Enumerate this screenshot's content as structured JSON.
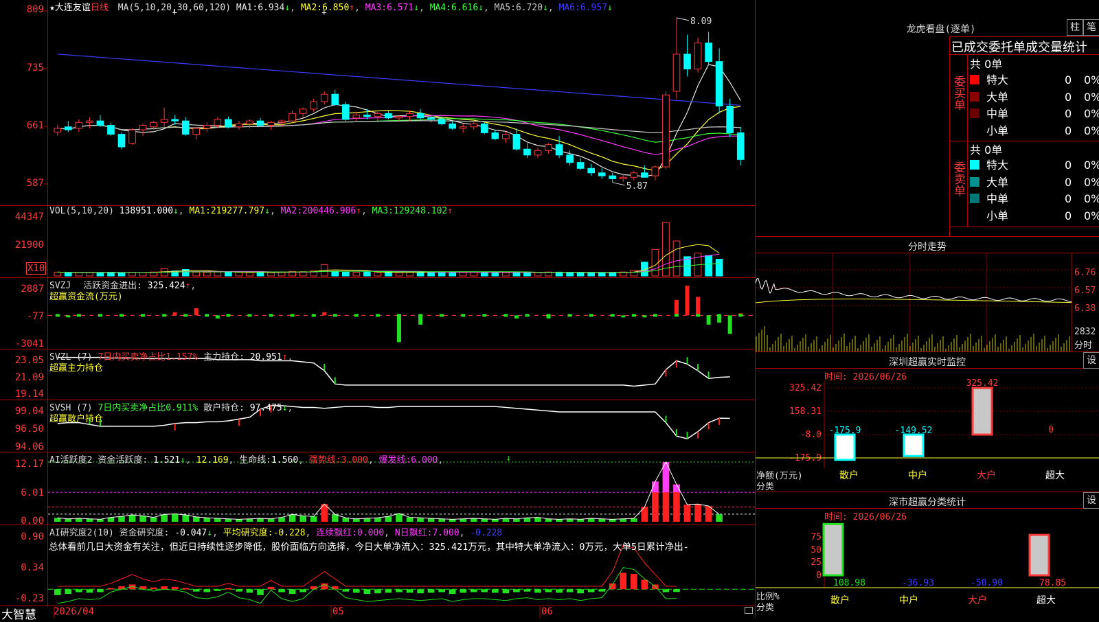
{
  "stock": {
    "star": "★",
    "name": "大连友谊",
    "period": "日线"
  },
  "main": {
    "ma_header": "MA(5,10,20,30,60,120)",
    "ma": [
      {
        "label": "MA1:",
        "value": "6.934",
        "arrow": "↓",
        "color": "#e6e6e6"
      },
      {
        "label": "MA2:",
        "value": "6.850",
        "arrow": "↑",
        "color": "#ffff3c"
      },
      {
        "label": "MA3:",
        "value": "6.571",
        "arrow": "↓",
        "color": "#ff3cff"
      },
      {
        "label": "MA4:",
        "value": "6.616",
        "arrow": "↓",
        "color": "#3cff3c"
      },
      {
        "label": "MA5:",
        "value": "6.720",
        "arrow": "↓",
        "color": "#c8c8c8"
      },
      {
        "label": "MA6:",
        "value": "6.957",
        "arrow": "↓",
        "color": "#3c3cff"
      }
    ],
    "y_labels": [
      "809",
      "735",
      "661",
      "587"
    ],
    "high_label": "8.09",
    "low_label": "5.87"
  },
  "vol": {
    "header": "VOL(5,10,20)",
    "value": "138951.000",
    "arrow": "↓",
    "ma": [
      {
        "label": "MA1:",
        "value": "219277.797",
        "arrow": "↓",
        "color": "#ffff3c"
      },
      {
        "label": "MA2:",
        "value": "200446.906",
        "arrow": "↑",
        "color": "#ff3cff"
      },
      {
        "label": "MA3:",
        "value": "129248.102",
        "arrow": "↑",
        "color": "#3cff3c"
      }
    ],
    "y_labels": [
      "44347",
      "21900"
    ],
    "unit": "X10"
  },
  "svzj": {
    "header": "SVZJ",
    "label": "活跃资金进出:",
    "value": "325.424",
    "arrow": "↑",
    "sub": "超赢资金流(万元)",
    "y_labels": [
      "2887",
      "-77",
      "-3041"
    ]
  },
  "svzl": {
    "header": "SVZL (7)",
    "ratio": "7日内买卖净占比1.157%",
    "label": "主力持仓:",
    "value": "20.951",
    "arrow": "↑",
    "sub": "超赢主力持仓",
    "y_labels": [
      "23.05",
      "21.09",
      "19.14"
    ]
  },
  "svsh": {
    "header": "SVSH (7)",
    "ratio": "7日内买卖净占比0.911%",
    "label": "散户持仓:",
    "value": "97.475",
    "arrow": "↓",
    "sub": "超赢散户持仓",
    "y_labels": [
      "99.04",
      "96.50",
      "94.06"
    ]
  },
  "ai1": {
    "header": "AI活跃度2",
    "label": "资金活跃度:",
    "value": "1.521",
    "arrow": "↓",
    "v2": "12.169",
    "label3": "生命线:",
    "v3": "1.560",
    "label4": "强势线:",
    "v4": "3.000",
    "label5": "爆发线:",
    "v5": "6.000",
    "y_labels": [
      "12.17",
      "6.01",
      "0.00"
    ]
  },
  "ai2": {
    "header": "AI研究度2(10)",
    "label": "资金研究度:",
    "value": "-0.047",
    "arrow": "↓",
    "label2": "平均研究度:",
    "v2": "-0.228",
    "label3": "连续飘红:",
    "v3": "0.000",
    "label4": "N日飘红:",
    "v4": "7.000",
    "v5": "-0.228",
    "summary": "总体看前几日大资金有关注，但近日持续性逐步降低，股价面临方向选择，今日大单净流入：325.421万元，其中特大单净流入：0万元，大单5日累计净出-",
    "y_labels": [
      "0.90",
      "0.34",
      "-0.23"
    ]
  },
  "xaxis": {
    "start": "2026/04",
    "m5": "05",
    "m6": "06"
  },
  "brand": "大智慧",
  "lhb": {
    "title": "龙虎看盘(逐单)",
    "btn_col": "柱",
    "btn_pen": "笔",
    "subtitle": "已成交委托单成交量统计",
    "buy": {
      "side": "委买单",
      "total": "共 0单",
      "rows": [
        {
          "name": "特大",
          "count": "0",
          "pct": "0%",
          "color": "#ff0000"
        },
        {
          "name": "大单",
          "count": "0",
          "pct": "0%",
          "color": "#8b0000"
        },
        {
          "name": "中单",
          "count": "0",
          "pct": "0%",
          "color": "#6a0000"
        },
        {
          "name": "小单",
          "count": "0",
          "pct": "0%",
          "color": "#000000"
        }
      ]
    },
    "sell": {
      "side": "委卖单",
      "total": "共 0单",
      "rows": [
        {
          "name": "特大",
          "count": "0",
          "pct": "0%",
          "color": "#00ffff"
        },
        {
          "name": "大单",
          "count": "0",
          "pct": "0%",
          "color": "#009090"
        },
        {
          "name": "中单",
          "count": "0",
          "pct": "0%",
          "color": "#007878"
        },
        {
          "name": "小单",
          "count": "0",
          "pct": "0%",
          "color": "#000000"
        }
      ]
    }
  },
  "intraday": {
    "title": "分时走势",
    "y_labels": [
      "6.76",
      "6.57",
      "6.38"
    ],
    "vol_label": "2832",
    "unit": "分时"
  },
  "szmon": {
    "title": "深圳超赢实时监控",
    "btn": "设",
    "time": "时间: 2026/06/26",
    "y_labels": [
      "325.42",
      "158.31",
      "-8.0",
      "-175.9"
    ],
    "net_label": "净额(万元)",
    "cat_label": "分类",
    "cats": [
      "散户",
      "中户",
      "大户",
      "超大"
    ],
    "values": [
      "-175.9",
      "-149.52",
      "325.42",
      "0"
    ]
  },
  "szcls": {
    "title": "深市超赢分类统计",
    "btn": "设",
    "time": "时间: 2026/06/26",
    "y_labels": [
      "75",
      "50",
      "25",
      "0"
    ],
    "ratio_label": "比例%",
    "cat_label": "分类",
    "cats": [
      "散户",
      "中户",
      "大户",
      "超大"
    ],
    "values": [
      "108.98",
      "-36.93",
      "-50.90",
      "78.85"
    ]
  },
  "chart_data": [
    {
      "type": "candlestick",
      "title": "大连友谊 日线",
      "x_start": "2026/04",
      "x_ticks": [
        "2026/04",
        "05",
        "06"
      ],
      "ylim": [
        5.6,
        8.2
      ],
      "high": 8.09,
      "low": 5.87,
      "ohlc": [
        [
          6.55,
          6.65,
          6.5,
          6.6
        ],
        [
          6.62,
          6.7,
          6.55,
          6.58
        ],
        [
          6.6,
          6.72,
          6.55,
          6.68
        ],
        [
          6.68,
          6.75,
          6.6,
          6.7
        ],
        [
          6.7,
          6.78,
          6.62,
          6.64
        ],
        [
          6.64,
          6.68,
          6.5,
          6.52
        ],
        [
          6.52,
          6.55,
          6.32,
          6.35
        ],
        [
          6.4,
          6.6,
          6.38,
          6.58
        ],
        [
          6.58,
          6.66,
          6.5,
          6.64
        ],
        [
          6.62,
          6.7,
          6.58,
          6.68
        ],
        [
          6.68,
          6.88,
          6.62,
          6.72
        ],
        [
          6.72,
          6.78,
          6.65,
          6.7
        ],
        [
          6.7,
          6.75,
          6.5,
          6.52
        ],
        [
          6.52,
          6.62,
          6.45,
          6.6
        ],
        [
          6.6,
          6.68,
          6.55,
          6.64
        ],
        [
          6.64,
          6.75,
          6.6,
          6.72
        ],
        [
          6.72,
          6.76,
          6.6,
          6.62
        ],
        [
          6.62,
          6.7,
          6.58,
          6.66
        ],
        [
          6.66,
          6.72,
          6.6,
          6.7
        ],
        [
          6.7,
          6.74,
          6.62,
          6.64
        ],
        [
          6.64,
          6.7,
          6.58,
          6.68
        ],
        [
          6.68,
          6.72,
          6.62,
          6.7
        ],
        [
          6.7,
          6.84,
          6.66,
          6.8
        ],
        [
          6.8,
          6.88,
          6.74,
          6.86
        ],
        [
          6.86,
          7.0,
          6.82,
          6.96
        ],
        [
          6.96,
          7.1,
          6.92,
          7.06
        ],
        [
          7.06,
          7.12,
          6.9,
          6.92
        ],
        [
          6.92,
          6.96,
          6.7,
          6.72
        ],
        [
          6.74,
          6.82,
          6.7,
          6.78
        ],
        [
          6.78,
          6.86,
          6.72,
          6.76
        ],
        [
          6.76,
          6.84,
          6.7,
          6.8
        ],
        [
          6.8,
          6.84,
          6.72,
          6.74
        ],
        [
          6.74,
          6.78,
          6.7,
          6.76
        ],
        [
          6.76,
          6.84,
          6.7,
          6.8
        ],
        [
          6.8,
          6.86,
          6.72,
          6.74
        ],
        [
          6.74,
          6.78,
          6.68,
          6.72
        ],
        [
          6.72,
          6.76,
          6.64,
          6.66
        ],
        [
          6.66,
          6.7,
          6.58,
          6.6
        ],
        [
          6.6,
          6.66,
          6.54,
          6.62
        ],
        [
          6.62,
          6.7,
          6.58,
          6.66
        ],
        [
          6.66,
          6.7,
          6.52,
          6.54
        ],
        [
          6.54,
          6.58,
          6.44,
          6.46
        ],
        [
          6.46,
          6.56,
          6.4,
          6.52
        ],
        [
          6.52,
          6.6,
          6.3,
          6.32
        ],
        [
          6.32,
          6.4,
          6.2,
          6.24
        ],
        [
          6.24,
          6.34,
          6.2,
          6.3
        ],
        [
          6.3,
          6.4,
          6.26,
          6.38
        ],
        [
          6.38,
          6.5,
          6.2,
          6.24
        ],
        [
          6.24,
          6.3,
          6.1,
          6.14
        ],
        [
          6.14,
          6.2,
          6.04,
          6.06
        ],
        [
          6.06,
          6.12,
          5.96,
          6.0
        ],
        [
          6.0,
          6.06,
          5.92,
          5.96
        ],
        [
          5.96,
          6.0,
          5.87,
          5.92
        ],
        [
          5.92,
          5.98,
          5.88,
          5.94
        ],
        [
          5.94,
          6.02,
          5.9,
          6.0
        ],
        [
          6.0,
          6.1,
          5.95,
          5.94
        ],
        [
          5.96,
          6.1,
          5.9,
          6.08
        ],
        [
          6.08,
          7.1,
          6.05,
          7.05
        ],
        [
          7.1,
          8.09,
          7.0,
          7.6
        ],
        [
          7.6,
          7.86,
          7.3,
          7.4
        ],
        [
          7.4,
          7.82,
          7.35,
          7.75
        ],
        [
          7.75,
          7.9,
          7.45,
          7.5
        ],
        [
          7.5,
          7.68,
          6.8,
          6.9
        ],
        [
          6.9,
          7.0,
          6.48,
          6.54
        ],
        [
          6.54,
          6.62,
          6.1,
          6.18
        ]
      ]
    },
    {
      "type": "bar",
      "title": "VOL(5,10,20)",
      "unit": "X10",
      "ylim": [
        0,
        44347
      ],
      "values": [
        3200,
        2800,
        3000,
        2900,
        2700,
        3100,
        2600,
        3000,
        2800,
        3300,
        6000,
        4200,
        5400,
        3200,
        3100,
        3300,
        3000,
        3100,
        2900,
        3000,
        2900,
        3100,
        3800,
        3600,
        4200,
        9500,
        4000,
        3200,
        3100,
        3300,
        3000,
        3100,
        2900,
        3000,
        3200,
        3400,
        3100,
        3000,
        2900,
        3200,
        3100,
        3000,
        2800,
        2700,
        2900,
        3000,
        3300,
        3200,
        2900,
        2800,
        2600,
        2700,
        2900,
        3300,
        4800,
        11500,
        22000,
        44347,
        29000,
        16000,
        19000,
        17000,
        13900
      ]
    },
    {
      "type": "bar",
      "title": "SVZJ",
      "ylim": [
        -3041,
        2887
      ],
      "values": [
        0,
        -200,
        0,
        0,
        0,
        0,
        0,
        0,
        0,
        0,
        0,
        300,
        0,
        700,
        0,
        -300,
        0,
        0,
        0,
        0,
        0,
        0,
        0,
        0,
        0,
        300,
        0,
        0,
        0,
        0,
        0,
        0,
        -2600,
        0,
        -900,
        0,
        0,
        0,
        0,
        0,
        0,
        0,
        0,
        -300,
        0,
        0,
        -300,
        0,
        0,
        0,
        0,
        0,
        0,
        -200,
        0,
        -200,
        0,
        0,
        1500,
        2887,
        1800,
        -900,
        -700,
        -1800,
        200,
        325
      ]
    },
    {
      "type": "line",
      "title": "SVZL (7)",
      "ylim": [
        19.14,
        23.05
      ],
      "values": [
        22.7,
        22.7,
        22.7,
        22.7,
        22.7,
        22.65,
        22.65,
        22.65,
        22.6,
        22.6,
        22.6,
        22.6,
        22.6,
        22.6,
        22.6,
        22.5,
        22.5,
        22.5,
        22.5,
        22.4,
        22.4,
        22.4,
        22.4,
        22.3,
        22.2,
        21.5,
        20.3,
        20.2,
        20.2,
        20.2,
        20.2,
        20.2,
        20.2,
        20.2,
        20.2,
        20.2,
        20.2,
        20.2,
        20.2,
        20.2,
        20.2,
        20.2,
        20.2,
        20.2,
        20.2,
        20.2,
        20.2,
        20.2,
        20.2,
        20.2,
        20.2,
        20.2,
        20.2,
        20.2,
        20.1,
        20.2,
        20.3,
        21.6,
        22.4,
        22.1,
        21.5,
        20.8,
        20.9,
        20.95
      ]
    },
    {
      "type": "line",
      "title": "SVSH (7)",
      "ylim": [
        94.06,
        99.04
      ],
      "values": [
        96.9,
        97.0,
        97.0,
        96.8,
        96.6,
        96.6,
        96.6,
        96.6,
        96.6,
        96.6,
        96.7,
        96.9,
        97.0,
        97.0,
        97.1,
        97.1,
        97.2,
        97.4,
        97.6,
        98.5,
        98.9,
        98.9,
        98.8,
        98.7,
        98.7,
        98.6,
        98.7,
        98.8,
        98.8,
        98.8,
        98.7,
        98.7,
        98.8,
        98.8,
        98.8,
        98.8,
        98.8,
        98.8,
        98.8,
        98.8,
        98.8,
        98.8,
        98.7,
        98.6,
        98.5,
        98.4,
        98.3,
        98.2,
        98.2,
        98.2,
        98.2,
        98.2,
        98.2,
        98.2,
        98.2,
        98.2,
        98.2,
        97.0,
        95.5,
        95.2,
        96.0,
        97.0,
        97.5,
        97.475
      ]
    },
    {
      "type": "bar",
      "title": "AI活跃度2",
      "ylim": [
        0,
        12.17
      ],
      "strong_line": 3.0,
      "burst_line": 6.0,
      "values": [
        0.8,
        0.6,
        0.7,
        0.6,
        0.5,
        0.9,
        1.1,
        1.4,
        1.2,
        0.9,
        1.5,
        1.6,
        1.4,
        1.0,
        0.8,
        0.7,
        0.6,
        0.5,
        0.6,
        0.7,
        0.6,
        0.9,
        1.5,
        1.2,
        1.1,
        3.6,
        1.5,
        0.8,
        0.6,
        0.7,
        0.8,
        1.1,
        1.7,
        0.9,
        0.8,
        0.7,
        0.6,
        0.5,
        0.6,
        0.7,
        0.6,
        0.5,
        0.7,
        0.6,
        0.8,
        0.9,
        0.6,
        0.5,
        0.6,
        0.5,
        0.7,
        0.6,
        0.5,
        0.6,
        0.7,
        3.0,
        8.2,
        12.17,
        7.6,
        3.5,
        3.6,
        3.2,
        1.52
      ]
    },
    {
      "type": "bar",
      "title": "AI研究度2(10)",
      "ylim": [
        -0.23,
        0.9
      ],
      "values": [
        -0.1,
        -0.08,
        -0.05,
        -0.06,
        -0.05,
        0.02,
        0.05,
        0.08,
        0.05,
        0.03,
        0.05,
        0.04,
        0.02,
        -0.04,
        -0.05,
        -0.03,
        0.02,
        -0.04,
        -0.06,
        -0.1,
        0.04,
        -0.05,
        -0.08,
        -0.05,
        0.05,
        0.1,
        0.05,
        -0.04,
        -0.06,
        -0.08,
        -0.07,
        -0.06,
        -0.05,
        -0.06,
        -0.07,
        -0.06,
        -0.05,
        -0.08,
        -0.06,
        -0.05,
        -0.05,
        -0.06,
        -0.07,
        -0.05,
        -0.04,
        -0.06,
        -0.05,
        -0.06,
        -0.05,
        -0.07,
        -0.05,
        -0.04,
        0.1,
        0.28,
        0.26,
        0.16,
        0.08,
        -0.05,
        -0.047
      ]
    }
  ]
}
